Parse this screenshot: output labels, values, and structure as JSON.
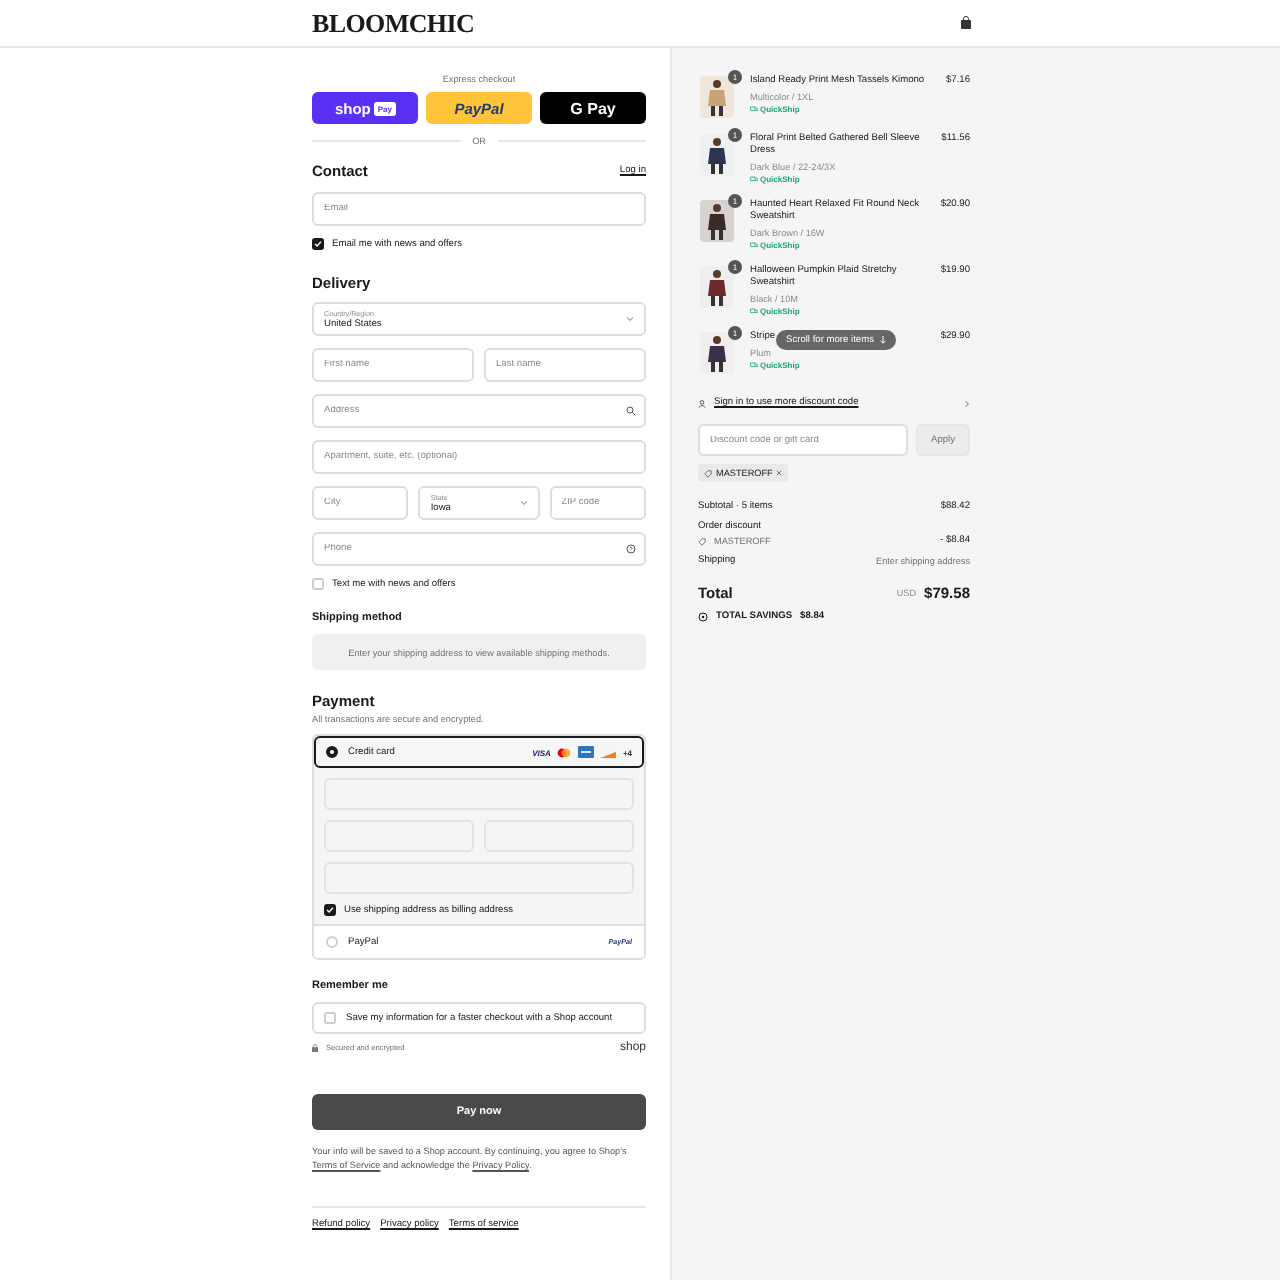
{
  "header": {
    "logo": "BLOOMCHIC"
  },
  "express": {
    "title": "Express checkout",
    "divider": "OR",
    "buttons": [
      {
        "kind": "shop",
        "label": "shop",
        "badge": "Pay"
      },
      {
        "kind": "paypal",
        "label": "PayPal"
      },
      {
        "kind": "gpay",
        "label": "G Pay"
      }
    ]
  },
  "contact": {
    "title": "Contact",
    "login": "Log in",
    "email": {
      "placeholder": "Email"
    },
    "newsletter": {
      "label": "Email me with news and offers",
      "checked": true
    }
  },
  "delivery": {
    "title": "Delivery",
    "rows": [
      [
        {
          "kind": "select",
          "label": "Country/Region",
          "value": "United States"
        }
      ],
      [
        {
          "kind": "input",
          "placeholder": "First name"
        },
        {
          "kind": "input",
          "placeholder": "Last name"
        }
      ],
      [
        {
          "kind": "search",
          "placeholder": "Address"
        }
      ],
      [
        {
          "kind": "input",
          "placeholder": "Apartment, suite, etc. (optional)"
        }
      ],
      [
        {
          "kind": "input",
          "placeholder": "City"
        },
        {
          "kind": "select",
          "label": "State",
          "value": "Iowa"
        },
        {
          "kind": "input",
          "placeholder": "ZIP code"
        }
      ],
      [
        {
          "kind": "help",
          "placeholder": "Phone"
        }
      ]
    ],
    "sms": {
      "label": "Text me with news and offers",
      "checked": false
    }
  },
  "shipping": {
    "title": "Shipping method",
    "message": "Enter your shipping address to view available shipping methods."
  },
  "payment": {
    "title": "Payment",
    "subtitle": "All transactions are secure and encrypted.",
    "methods": [
      {
        "kind": "card",
        "label": "Credit card",
        "selected": true,
        "brand_text": "VISA",
        "more": "+4",
        "billing": {
          "label": "Use shipping address as billing address",
          "checked": true
        }
      },
      {
        "kind": "paypal",
        "label": "PayPal",
        "selected": false,
        "logo": "PayPal"
      }
    ]
  },
  "remember": {
    "title": "Remember me",
    "label": "Save my information for a faster checkout with a Shop account",
    "checked": false,
    "secure": "Secured and encrypted",
    "brand": "shop"
  },
  "pay_button": "Pay now",
  "notice": {
    "before": "Your info will be saved to a Shop account. By continuing, you agree to Shop's",
    "terms": "Terms of Service",
    "middle": "and acknowledge the",
    "privacy": "Privacy Policy",
    "after": "."
  },
  "footer_links": [
    "Refund policy",
    "Privacy policy",
    "Terms of service"
  ],
  "summary": {
    "items": [
      {
        "name": "Island Ready Print Mesh Tassels Kimono",
        "variant": "Multicolor / 1XL",
        "tag": "QuickShip",
        "price": "$7.16",
        "quantity": "1"
      },
      {
        "name": "Floral Print Belted Gathered Bell Sleeve Dress",
        "variant": "Dark Blue / 22-24/3X",
        "tag": "QuickShip",
        "price": "$11.56",
        "quantity": "1"
      },
      {
        "name": "Haunted Heart Relaxed Fit Round Neck Sweatshirt",
        "variant": "Dark Brown / 16W",
        "tag": "QuickShip",
        "price": "$20.90",
        "quantity": "1"
      },
      {
        "name": "Halloween Pumpkin Plaid Stretchy Sweatshirt",
        "variant": "Black / 10M",
        "tag": "QuickShip",
        "price": "$19.90",
        "quantity": "1"
      },
      {
        "name": "Stripe",
        "variant": "Plum",
        "tag": "QuickShip",
        "price": "$29.90",
        "quantity": "1"
      }
    ],
    "scroll_hint": "Scroll for more items",
    "signin": "Sign in to use more discount code",
    "discount": {
      "placeholder": "Discount code or gift card",
      "button": "Apply",
      "tag": "MASTEROFF"
    },
    "subtotal": {
      "label": "Subtotal · 5 items",
      "value": "$88.42"
    },
    "order_discount": {
      "label": "Order discount",
      "code": "MASTEROFF",
      "value": "- $8.84"
    },
    "shipping": {
      "label": "Shipping",
      "value": "Enter shipping address"
    },
    "total": {
      "label": "Total",
      "currency": "USD",
      "value": "$79.58"
    },
    "savings": {
      "label": "TOTAL SAVINGS",
      "value": "$8.84"
    }
  }
}
